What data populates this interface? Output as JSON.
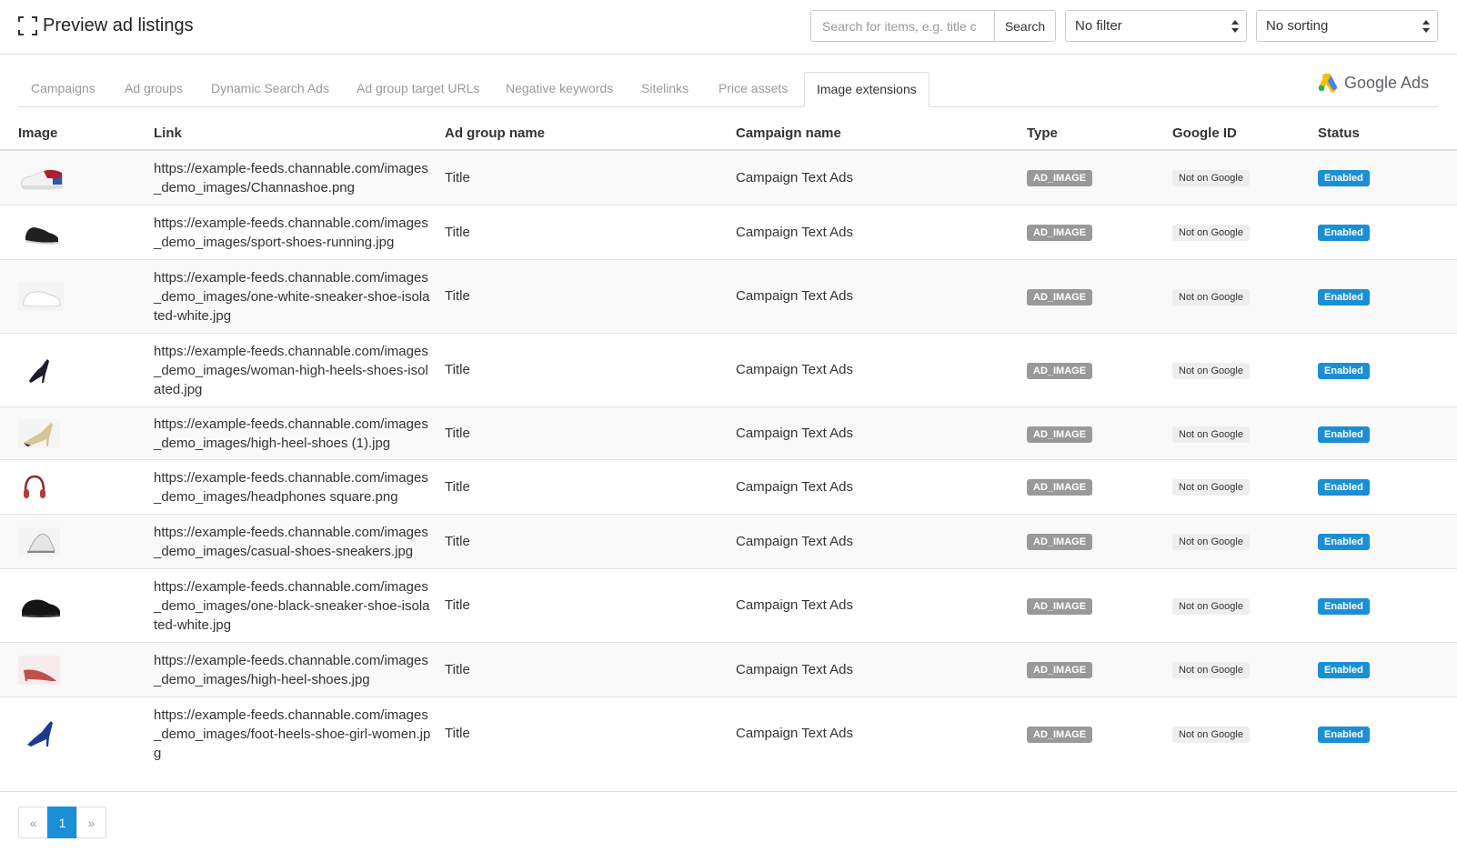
{
  "header": {
    "title": "Preview ad listings",
    "search_placeholder": "Search for items, e.g. title c",
    "search_button": "Search",
    "filter_value": "No filter",
    "sorting_value": "No sorting"
  },
  "tabs": [
    {
      "label": "Campaigns",
      "active": false
    },
    {
      "label": "Ad groups",
      "active": false
    },
    {
      "label": "Dynamic Search Ads",
      "active": false
    },
    {
      "label": "Ad group target URLs",
      "active": false
    },
    {
      "label": "Negative keywords",
      "active": false
    },
    {
      "label": "Sitelinks",
      "active": false
    },
    {
      "label": "Price assets",
      "active": false
    },
    {
      "label": "Image extensions",
      "active": true
    }
  ],
  "brand": {
    "label": "Google Ads"
  },
  "table": {
    "columns": [
      "Image",
      "Link",
      "Ad group name",
      "Campaign name",
      "Type",
      "Google ID",
      "Status"
    ],
    "rows": [
      {
        "image": "sneaker-red-white-thumbnail",
        "link": "https://example-feeds.channable.com/images_demo_images/Channashoe.png",
        "ad_group": "Title",
        "campaign": "Campaign Text Ads",
        "type": "AD_IMAGE",
        "google_id": "Not on Google",
        "status": "Enabled"
      },
      {
        "image": "black-sport-shoe-thumbnail",
        "link": "https://example-feeds.channable.com/images_demo_images/sport-shoes-running.jpg",
        "ad_group": "Title",
        "campaign": "Campaign Text Ads",
        "type": "AD_IMAGE",
        "google_id": "Not on Google",
        "status": "Enabled"
      },
      {
        "image": "white-sneaker-thumbnail",
        "link": "https://example-feeds.channable.com/images_demo_images/one-white-sneaker-shoe-isolated-white.jpg",
        "ad_group": "Title",
        "campaign": "Campaign Text Ads",
        "type": "AD_IMAGE",
        "google_id": "Not on Google",
        "status": "Enabled"
      },
      {
        "image": "black-high-heel-thumbnail",
        "link": "https://example-feeds.channable.com/images_demo_images/woman-high-heels-shoes-isolated.jpg",
        "ad_group": "Title",
        "campaign": "Campaign Text Ads",
        "type": "AD_IMAGE",
        "google_id": "Not on Google",
        "status": "Enabled"
      },
      {
        "image": "beige-high-heel-thumbnail",
        "link": "https://example-feeds.channable.com/images_demo_images/high-heel-shoes (1).jpg",
        "ad_group": "Title",
        "campaign": "Campaign Text Ads",
        "type": "AD_IMAGE",
        "google_id": "Not on Google",
        "status": "Enabled"
      },
      {
        "image": "headphones-thumbnail",
        "link": "https://example-feeds.channable.com/images_demo_images/headphones square.png",
        "ad_group": "Title",
        "campaign": "Campaign Text Ads",
        "type": "AD_IMAGE",
        "google_id": "Not on Google",
        "status": "Enabled"
      },
      {
        "image": "casual-sneaker-thumbnail",
        "link": "https://example-feeds.channable.com/images_demo_images/casual-shoes-sneakers.jpg",
        "ad_group": "Title",
        "campaign": "Campaign Text Ads",
        "type": "AD_IMAGE",
        "google_id": "Not on Google",
        "status": "Enabled"
      },
      {
        "image": "black-sneaker-thumbnail",
        "link": "https://example-feeds.channable.com/images_demo_images/one-black-sneaker-shoe-isolated-white.jpg",
        "ad_group": "Title",
        "campaign": "Campaign Text Ads",
        "type": "AD_IMAGE",
        "google_id": "Not on Google",
        "status": "Enabled"
      },
      {
        "image": "red-high-heel-thumbnail",
        "link": "https://example-feeds.channable.com/images_demo_images/high-heel-shoes.jpg",
        "ad_group": "Title",
        "campaign": "Campaign Text Ads",
        "type": "AD_IMAGE",
        "google_id": "Not on Google",
        "status": "Enabled"
      },
      {
        "image": "blue-high-heel-thumbnail",
        "link": "https://example-feeds.channable.com/images_demo_images/foot-heels-shoe-girl-women.jpg",
        "ad_group": "Title",
        "campaign": "Campaign Text Ads",
        "type": "AD_IMAGE",
        "google_id": "Not on Google",
        "status": "Enabled"
      }
    ]
  },
  "pagination": {
    "prev": "«",
    "current": "1",
    "next": "»"
  },
  "colors": {
    "accent": "#1b8fd6",
    "type_badge": "#999999",
    "google_badge": "#eeeeee"
  }
}
